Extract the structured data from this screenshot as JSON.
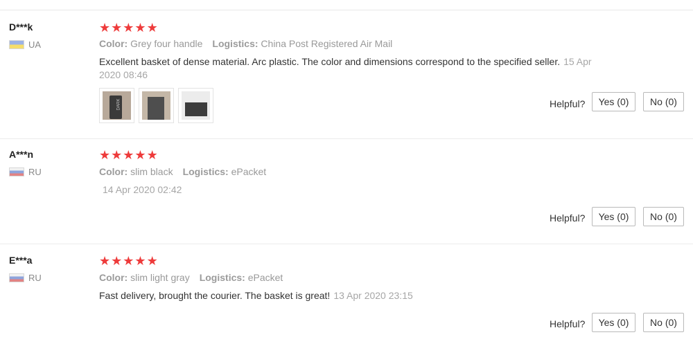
{
  "helpful_label": "Helpful?",
  "star_color": "#ee3b3b",
  "reviews": [
    {
      "buyer": "D***k",
      "country": "UA",
      "rating": 5,
      "color_label": "Color:",
      "color_value": "Grey four handle",
      "logistics_label": "Logistics:",
      "logistics_value": "China Post Registered Air Mail",
      "text": "Excellent basket of dense material. Arc plastic. The color and dimensions correspond to the specified seller.",
      "date": "15 Apr 2020 08:46",
      "yes": "Yes (0)",
      "no": "No (0)"
    },
    {
      "buyer": "A***n",
      "country": "RU",
      "rating": 5,
      "color_label": "Color:",
      "color_value": "slim black",
      "logistics_label": "Logistics:",
      "logistics_value": "ePacket",
      "date": "14 Apr 2020 02:42",
      "yes": "Yes (0)",
      "no": "No (0)"
    },
    {
      "buyer": "E***a",
      "country": "RU",
      "rating": 5,
      "color_label": "Color:",
      "color_value": "slim light gray",
      "logistics_label": "Logistics:",
      "logistics_value": "ePacket",
      "text": "Fast delivery, brought the courier. The basket is great!",
      "date": "13 Apr 2020 23:15",
      "yes": "Yes (0)",
      "no": "No (0)"
    }
  ]
}
